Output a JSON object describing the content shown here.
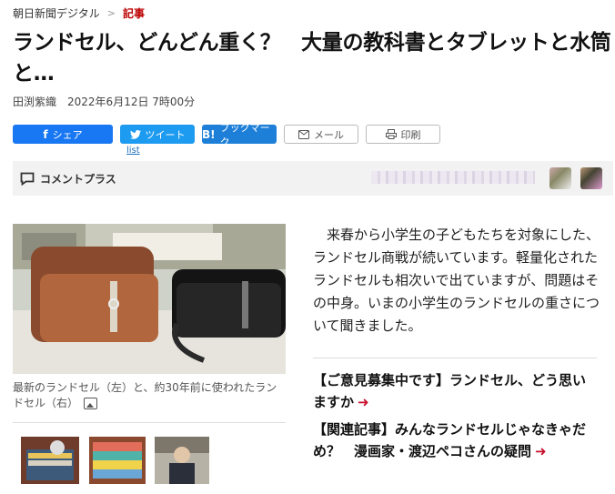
{
  "breadcrumb": {
    "site": "朝日新聞デジタル",
    "separator": ">",
    "current": "記事"
  },
  "article": {
    "title": "ランドセル、どんどん重く？　大量の教科書とタブレットと水筒と…",
    "author": "田渕紫織",
    "date": "2022年6月12日 7時00分"
  },
  "share": {
    "facebook": "シェア",
    "twitter": "ツイート",
    "hatena": "ブックマーク",
    "hatena_icon": "B!",
    "mail": "メール",
    "print": "印刷",
    "list_link": "list"
  },
  "comment": {
    "label": "コメントプラス"
  },
  "photo": {
    "caption": "最新のランドセル（左）と、約30年前に使われたランドセル（右）"
  },
  "lead": "来春から小学生の子どもたちを対象にした、ランドセル商戦が続いています。軽量化されたランドセルも相次いで出ていますが、問題はその中身。いまの小学生のランドセルの重さについて聞きました。",
  "related": [
    {
      "text": "【ご意見募集中です】ランドセル、どう思いますか"
    },
    {
      "text": "【関連記事】みんなランドセルじゃなきゃだめ？　漫画家・渡辺ペコさんの疑問"
    }
  ],
  "colors": {
    "accent": "#c8102e",
    "facebook": "#1877f2",
    "twitter": "#1d9bf0",
    "hatena": "#1e7fd8"
  }
}
